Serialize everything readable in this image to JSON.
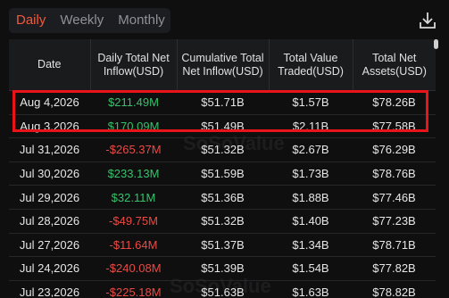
{
  "tabs": [
    {
      "label": "Daily",
      "active": true
    },
    {
      "label": "Weekly",
      "active": false
    },
    {
      "label": "Monthly",
      "active": false
    }
  ],
  "download_icon": "download-icon",
  "watermark": "SoSoValue",
  "columns": [
    "Date",
    "Daily Total Net Inflow(USD)",
    "Cumulative Total Net Inflow(USD)",
    "Total Value Traded(USD)",
    "Total Net Assets(USD)"
  ],
  "rows": [
    {
      "date": "Aug 4,2026",
      "inflow": "$211.49M",
      "sign": "pos",
      "cumulative": "$51.71B",
      "traded": "$1.57B",
      "assets": "$78.26B"
    },
    {
      "date": "Aug 3,2026",
      "inflow": "$170.09M",
      "sign": "pos",
      "cumulative": "$51.49B",
      "traded": "$2.11B",
      "assets": "$77.58B"
    },
    {
      "date": "Jul 31,2026",
      "inflow": "-$265.37M",
      "sign": "neg",
      "cumulative": "$51.32B",
      "traded": "$2.67B",
      "assets": "$76.29B"
    },
    {
      "date": "Jul 30,2026",
      "inflow": "$233.13M",
      "sign": "pos",
      "cumulative": "$51.59B",
      "traded": "$1.73B",
      "assets": "$78.76B"
    },
    {
      "date": "Jul 29,2026",
      "inflow": "$32.11M",
      "sign": "pos",
      "cumulative": "$51.36B",
      "traded": "$1.88B",
      "assets": "$77.46B"
    },
    {
      "date": "Jul 28,2026",
      "inflow": "-$49.75M",
      "sign": "neg",
      "cumulative": "$51.32B",
      "traded": "$1.40B",
      "assets": "$77.23B"
    },
    {
      "date": "Jul 27,2026",
      "inflow": "-$11.64M",
      "sign": "neg",
      "cumulative": "$51.37B",
      "traded": "$1.34B",
      "assets": "$78.71B"
    },
    {
      "date": "Jul 24,2026",
      "inflow": "-$240.08M",
      "sign": "neg",
      "cumulative": "$51.39B",
      "traded": "$1.54B",
      "assets": "$77.82B"
    },
    {
      "date": "Jul 23,2026",
      "inflow": "-$225.18M",
      "sign": "neg",
      "cumulative": "$51.63B",
      "traded": "$1.63B",
      "assets": "$78.82B"
    }
  ],
  "colors": {
    "accent": "#ef5a3c",
    "positive": "#36c26a",
    "negative": "#ea4a43",
    "highlight": "#e8141a"
  }
}
